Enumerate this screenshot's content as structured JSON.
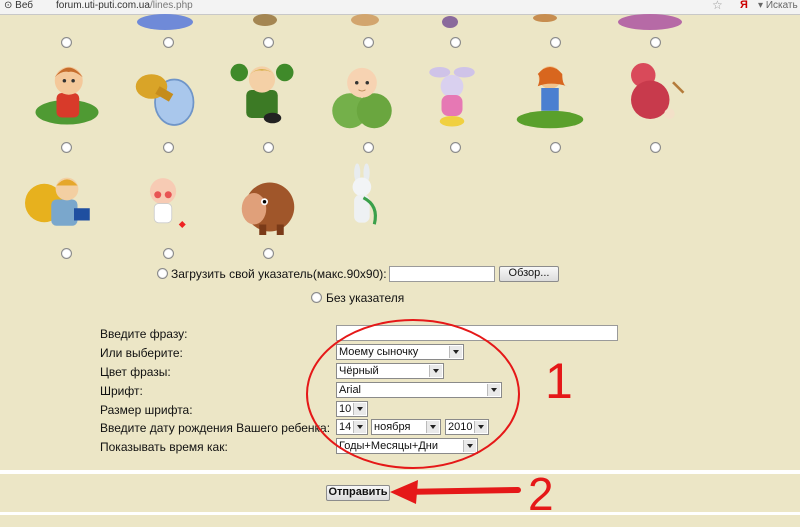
{
  "browser": {
    "tab_label": "Веб",
    "url_host": "forum.uti-puti.com.ua",
    "url_path": "/lines.php",
    "search_label": "Искать",
    "yandex_letter": "Я"
  },
  "upload": {
    "label": "Загрузить свой указатель(макс.90x90):",
    "browse_button": "Обзор..."
  },
  "no_pointer_label": "Без указателя",
  "form": {
    "phrase_label": "Введите фразу:",
    "choose_label": "Или выберите:",
    "choose_value": "Моему сыночку",
    "color_label": "Цвет фразы:",
    "color_value": "Чёрный",
    "font_label": "Шрифт:",
    "font_value": "Arial",
    "size_label": "Размер шрифта:",
    "size_value": "10",
    "date_label": "Введите дату рождения Вашего ребенка:",
    "day_value": "14",
    "month_value": "ноября",
    "year_value": "2010",
    "show_label": "Показывать время как:",
    "show_value": "Годы+Месяцы+Дни",
    "submit_label": "Отправить"
  },
  "annotations": {
    "one": "1",
    "two": "2",
    "color": "#e51818"
  },
  "pictures": [
    "girl-in-leaves-icon",
    "pacifier-icon",
    "clover-boy-icon",
    "baby-in-cabbage-icon",
    "bunny-icon",
    "girl-on-grass-icon",
    "pink-creature-icon",
    "reading-child-icon",
    "baby-with-flower-icon",
    "mammoth-icon",
    "white-rabbit-icon"
  ]
}
